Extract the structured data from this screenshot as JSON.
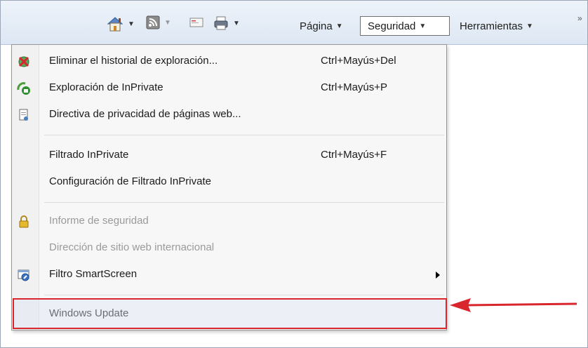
{
  "toolbar": {
    "home_icon": "home-icon",
    "feeds_icon": "feeds-icon",
    "mail_icon": "mail-icon",
    "print_icon": "print-icon",
    "page_label": "Página",
    "security_label": "Seguridad",
    "tools_label": "Herramientas",
    "more_label": "»"
  },
  "menu": {
    "items": [
      {
        "label": "Eliminar el historial de exploración...",
        "shortcut": "Ctrl+Mayús+Del",
        "icon": "delete-history-icon"
      },
      {
        "label": "Exploración de InPrivate",
        "shortcut": "Ctrl+Mayús+P",
        "icon": "inprivate-icon"
      },
      {
        "label": "Directiva de privacidad de páginas web...",
        "shortcut": "",
        "icon": "privacy-policy-icon"
      },
      {
        "label": "Filtrado InPrivate",
        "shortcut": "Ctrl+Mayús+F"
      },
      {
        "label": "Configuración de Filtrado InPrivate",
        "shortcut": ""
      },
      {
        "label": "Informe de seguridad",
        "shortcut": "",
        "icon": "lock-icon",
        "disabled": true
      },
      {
        "label": "Dirección de sitio web internacional",
        "shortcut": "",
        "disabled": true
      },
      {
        "label": "Filtro SmartScreen",
        "shortcut": "",
        "icon": "smartscreen-icon",
        "submenu": true
      },
      {
        "label": "Windows Update",
        "shortcut": ""
      }
    ]
  },
  "colors": {
    "highlight_border": "#d9262d",
    "arrow": "#d9262d"
  }
}
